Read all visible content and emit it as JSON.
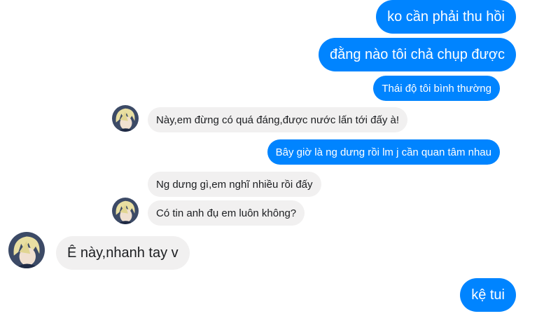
{
  "conversation": {
    "messages": [
      {
        "text": "ko cần phải thu hồi",
        "from": "me"
      },
      {
        "text": "đằng nào tôi chả chụp được",
        "from": "me"
      },
      {
        "text": "Thái độ tôi bình thường",
        "from": "me"
      },
      {
        "text": "Này,em đừng có quá đáng,được nước lấn tới đấy à!",
        "from": "contact"
      },
      {
        "text": "Bây giờ là ng dưng rồi lm j cần quan tâm nhau",
        "from": "me"
      },
      {
        "text": "Ng dưng gì,em nghĩ nhiều rồi đấy",
        "from": "contact"
      },
      {
        "text": "Có tin anh đụ em luôn không?",
        "from": "contact"
      },
      {
        "text": "Ê này,nhanh tay v",
        "from": "contact"
      },
      {
        "text": "kệ tui",
        "from": "me"
      }
    ]
  },
  "colors": {
    "outgoing_bubble": "#0084ff",
    "incoming_bubble": "#f1f0f0",
    "background": "#ffffff"
  },
  "icons": {
    "avatar": "contact-avatar-anime-character"
  }
}
